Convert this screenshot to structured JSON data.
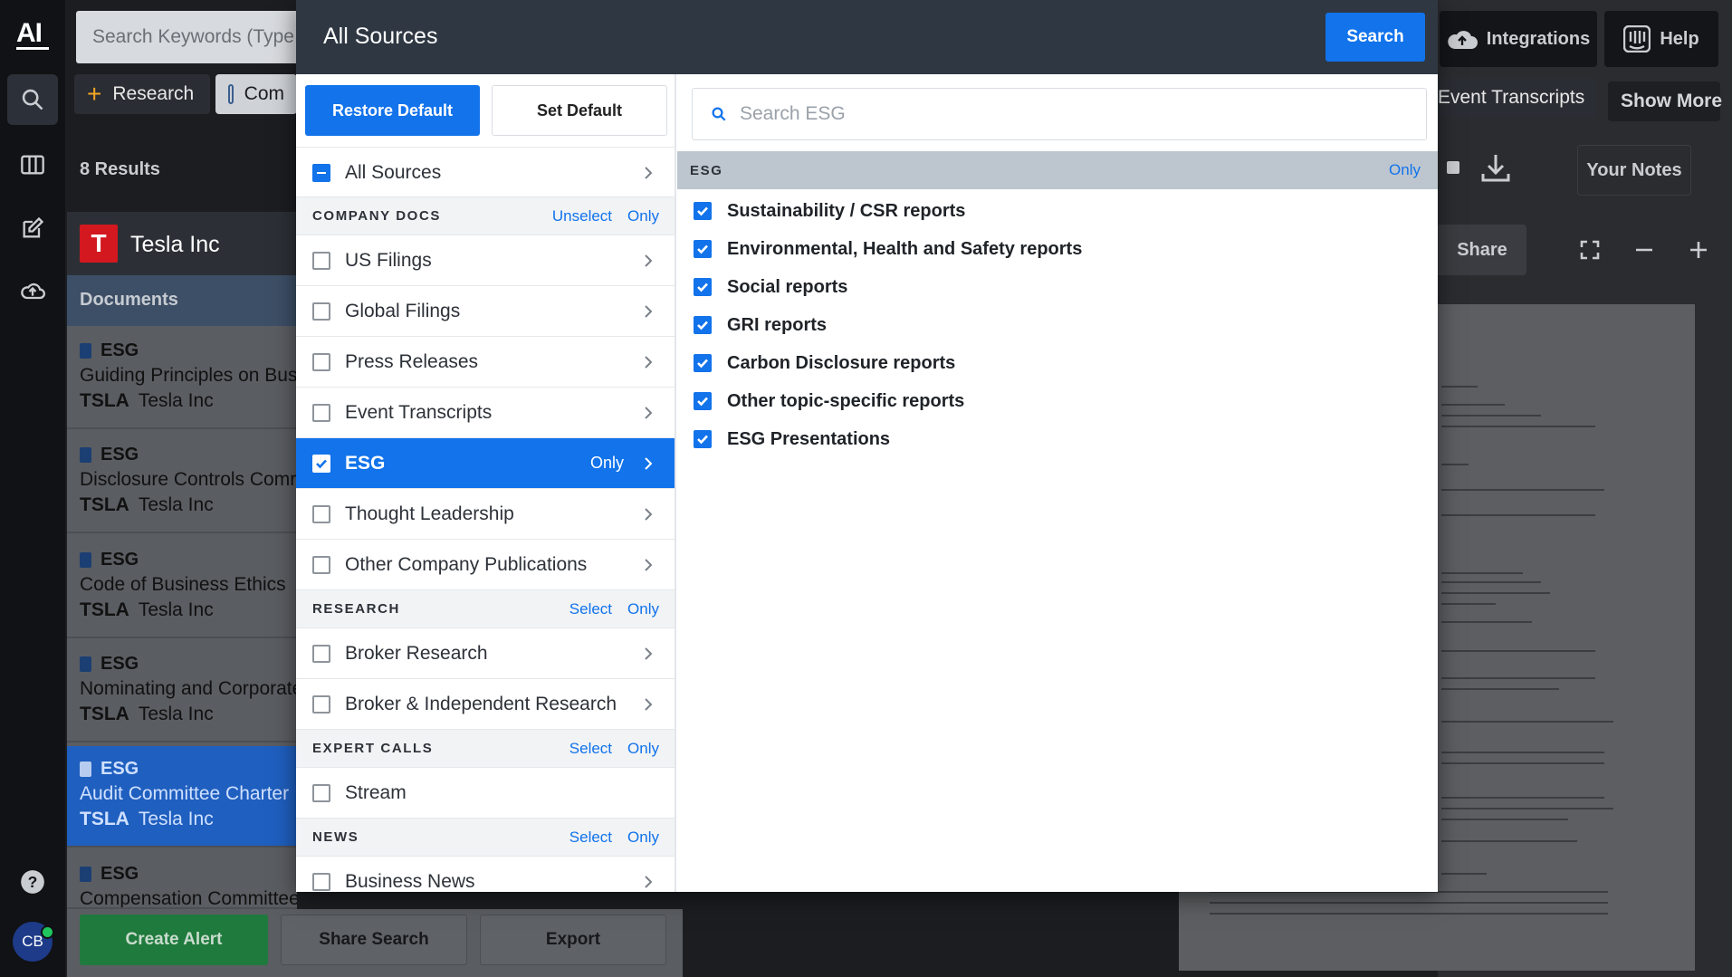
{
  "app": {
    "logo_text": "AI"
  },
  "rail": {
    "avatar_initials": "CB"
  },
  "background": {
    "search_placeholder": "Search Keywords (Type",
    "chips": {
      "research": "Research",
      "company": "Com",
      "event_transcripts": "Event Transcripts",
      "show_more": "Show More"
    },
    "header_buttons": {
      "integrations": "Integrations",
      "help": "Help",
      "your_notes": "Your Notes",
      "share": "Share"
    },
    "results_count": "8 Results",
    "company": {
      "name": "Tesla Inc",
      "logo_letter": "T"
    },
    "documents_label": "Documents",
    "documents": [
      {
        "tag": "ESG",
        "title": "Guiding Principles on Bus",
        "ticker": "TSLA",
        "company": "Tesla Inc"
      },
      {
        "tag": "ESG",
        "title": "Disclosure Controls Comr",
        "ticker": "TSLA",
        "company": "Tesla Inc"
      },
      {
        "tag": "ESG",
        "title": "Code of Business Ethics",
        "ticker": "TSLA",
        "company": "Tesla Inc"
      },
      {
        "tag": "ESG",
        "title": "Nominating and Corporate",
        "ticker": "TSLA",
        "company": "Tesla Inc"
      },
      {
        "tag": "ESG",
        "title": "Audit Committee Charter",
        "ticker": "TSLA",
        "company": "Tesla Inc"
      },
      {
        "tag": "ESG",
        "title": "Compensation Committee Charter",
        "ticker": "",
        "company": ""
      }
    ],
    "bottom_buttons": {
      "create_alert": "Create Alert",
      "share_search": "Share Search",
      "export": "Export"
    }
  },
  "modal": {
    "title": "All Sources",
    "search_button": "Search",
    "restore_default": "Restore Default",
    "set_default": "Set Default",
    "all_sources": "All Sources",
    "sections": {
      "company_docs": {
        "title": "COMPANY DOCS",
        "action1": "Unselect",
        "action2": "Only"
      },
      "research": {
        "title": "RESEARCH",
        "action1": "Select",
        "action2": "Only"
      },
      "expert_calls": {
        "title": "EXPERT CALLS",
        "action1": "Select",
        "action2": "Only"
      },
      "news": {
        "title": "NEWS",
        "action1": "Select",
        "action2": "Only"
      }
    },
    "company_docs_items": [
      "US Filings",
      "Global Filings",
      "Press Releases",
      "Event Transcripts",
      "ESG",
      "Thought Leadership",
      "Other Company Publications"
    ],
    "selected_only_label": "Only",
    "research_items": [
      "Broker Research",
      "Broker & Independent Research"
    ],
    "expert_calls_items": [
      "Stream"
    ],
    "news_items": [
      "Business News"
    ],
    "esg_panel": {
      "search_placeholder": "Search ESG",
      "header": "ESG",
      "header_action": "Only",
      "items": [
        "Sustainability / CSR reports",
        "Environmental, Health and Safety reports",
        "Social reports",
        "GRI reports",
        "Carbon Disclosure reports",
        "Other topic-specific reports",
        "ESG Presentations"
      ]
    }
  }
}
